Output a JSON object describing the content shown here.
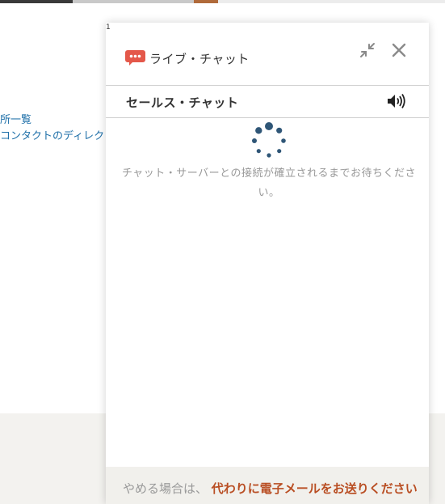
{
  "background": {
    "links": [
      "所一覧",
      "コンタクトのディレク"
    ]
  },
  "widget": {
    "corner_mark": "1",
    "header": {
      "title": "ライブ・チャット",
      "icons": {
        "logo": "speech-bubble-icon",
        "minimize": "minimize-arrows-icon",
        "close": "close-icon"
      }
    },
    "subheader": {
      "title": "セールス・チャット",
      "icons": {
        "sound": "speaker-icon"
      }
    },
    "status": {
      "text": "チャット・サーバーとの接続が確立されるまでお待ちください。"
    },
    "footer": {
      "prefix": "やめる場合は、",
      "link": "代わりに電子メールをお送りください"
    }
  },
  "colors": {
    "accent": "#e4584a",
    "spinner": "#2f5677",
    "link": "#b94e23",
    "bg_link": "#1e6fa8"
  }
}
